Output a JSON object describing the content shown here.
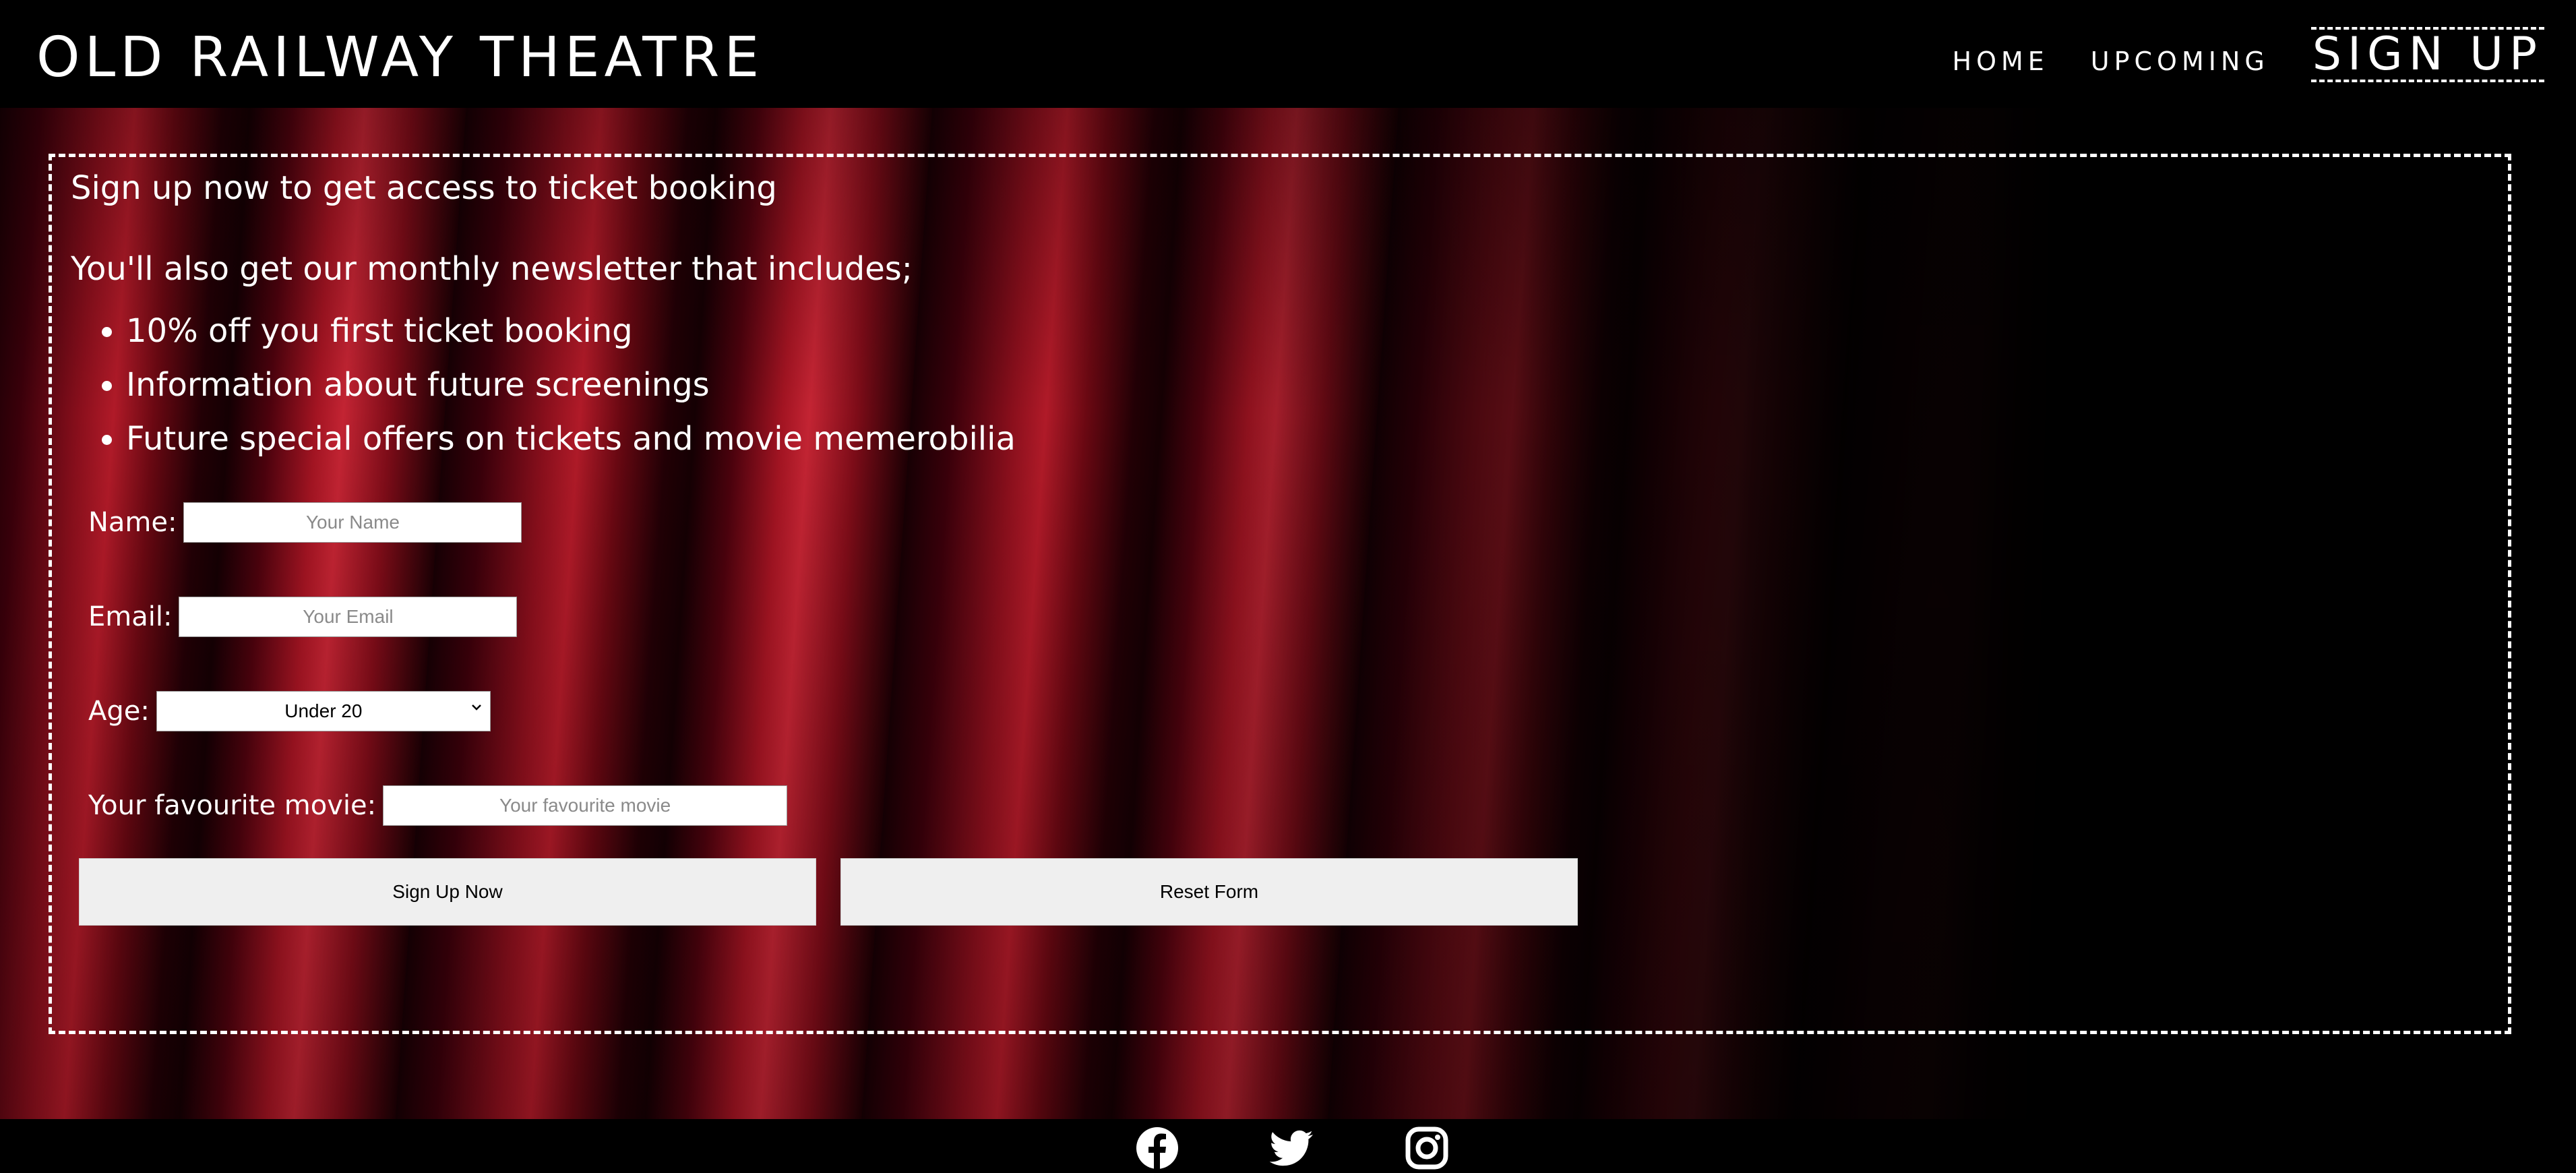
{
  "brand": "OLD RAILWAY THEATRE",
  "nav": {
    "home": "HOME",
    "upcoming": "UPCOMING",
    "signup": "SIGN UP"
  },
  "signup": {
    "heading": "Sign up now to get access to ticket booking",
    "newsletter_intro": "You'll also get our monthly newsletter that includes;",
    "perks": [
      "10% off you first ticket booking",
      "Information about future screenings",
      "Future special offers on tickets and movie memerobilia"
    ]
  },
  "form": {
    "name_label": "Name:",
    "name_placeholder": "Your Name",
    "email_label": "Email:",
    "email_placeholder": "Your Email",
    "age_label": "Age:",
    "age_value": "Under 20",
    "movie_label": "Your favourite movie:",
    "movie_placeholder": "Your favourite movie",
    "submit_label": "Sign Up Now",
    "reset_label": "Reset Form"
  },
  "footer": {
    "icons": [
      "facebook-icon",
      "twitter-icon",
      "instagram-icon"
    ]
  },
  "colors": {
    "header_bg": "#000000",
    "curtain_red": "#b01a28",
    "button_bg": "#efefef"
  }
}
